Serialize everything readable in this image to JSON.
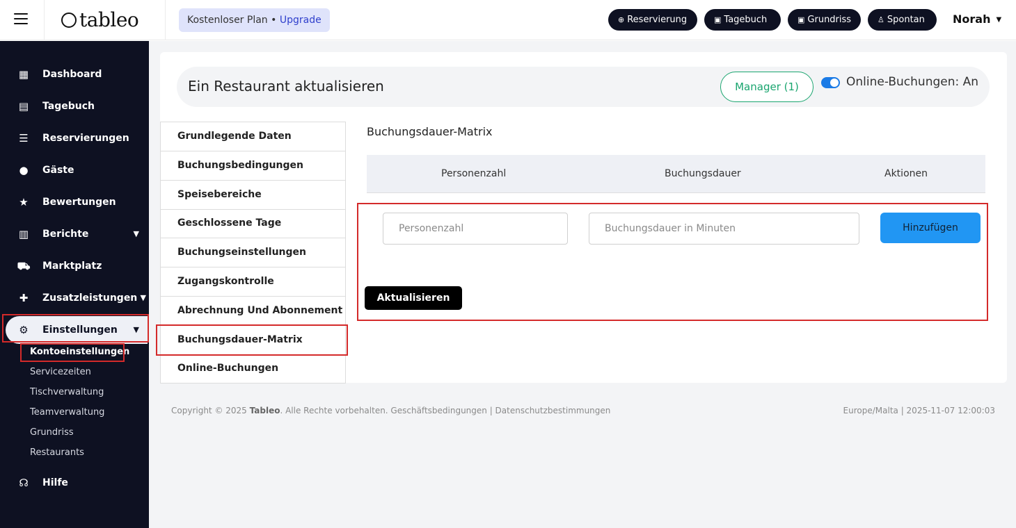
{
  "app": {
    "logo_text": "tableo"
  },
  "plan": {
    "text": "Kostenloser Plan • ",
    "upgrade": "Upgrade"
  },
  "top_buttons": [
    {
      "label": "Reservierung",
      "icon": "plus-circle-icon"
    },
    {
      "label": "Tagebuch",
      "icon": "calendar-icon"
    },
    {
      "label": "Grundriss",
      "icon": "floorplan-icon"
    },
    {
      "label": "Spontan",
      "icon": "walk-icon"
    }
  ],
  "user": {
    "name": "Norah"
  },
  "sidebar": {
    "items": [
      {
        "label": "Dashboard",
        "icon": "dashboard-icon"
      },
      {
        "label": "Tagebuch",
        "icon": "book-icon"
      },
      {
        "label": "Reservierungen",
        "icon": "list-icon"
      },
      {
        "label": "Gäste",
        "icon": "user-icon"
      },
      {
        "label": "Bewertungen",
        "icon": "star-icon"
      },
      {
        "label": "Berichte",
        "icon": "chart-icon"
      },
      {
        "label": "Marktplatz",
        "icon": "cart-icon"
      },
      {
        "label": "Zusatzleistungen",
        "icon": "puzzle-icon"
      },
      {
        "label": "Einstellungen",
        "icon": "gear-icon"
      },
      {
        "label": "Hilfe",
        "icon": "headset-icon"
      }
    ],
    "sub_items": [
      "Kontoeinstellungen",
      "Servicezeiten",
      "Tischverwaltung",
      "Teamverwaltung",
      "Grundriss",
      "Restaurants"
    ]
  },
  "page": {
    "title": "Ein Restaurant aktualisieren",
    "manager_button": "Manager (1)",
    "online_toggle_label": "Online-Buchungen: An",
    "online_toggle_on": true
  },
  "tabs": [
    "Grundlegende Daten",
    "Buchungsbedingungen",
    "Speisebereiche",
    "Geschlossene Tage",
    "Buchungseinstellungen",
    "Zugangskontrolle",
    "Abrechnung Und Abonnement",
    "Buchungsdauer-Matrix",
    "Online-Buchungen"
  ],
  "matrix": {
    "title": "Buchungsdauer-Matrix",
    "columns": [
      "Personenzahl",
      "Buchungsdauer",
      "Aktionen"
    ],
    "persons_placeholder": "Personenzahl",
    "duration_placeholder": "Buchungsdauer in Minuten",
    "add_button": "Hinzufügen",
    "update_button": "Aktualisieren"
  },
  "footer": {
    "copyright_prefix": "Copyright © 2025 ",
    "brand": "Tableo",
    "copyright_suffix": ". Alle Rechte vorbehalten. Geschäftsbedingungen | Datenschutzbestimmungen",
    "timezone_time": "Europe/Malta | 2025-11-07 12:00:03"
  },
  "colors": {
    "sidebar_bg": "#0e1122",
    "accent_blue": "#2196f3",
    "manager_green": "#1aa56f",
    "highlight_red": "#d42a2a"
  }
}
